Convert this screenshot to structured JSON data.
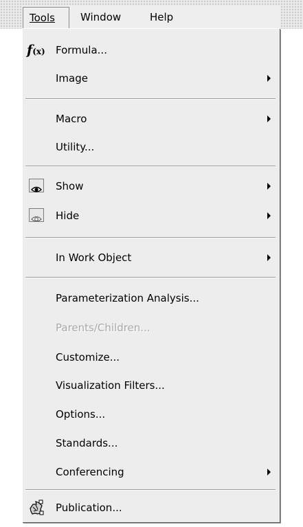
{
  "menubar": {
    "tools": "Tools",
    "window": "Window",
    "help": "Help"
  },
  "menu": {
    "formula": "Formula...",
    "image": "Image",
    "macro": "Macro",
    "utility": "Utility...",
    "show": "Show",
    "hide": "Hide",
    "in_work_object": "In Work Object",
    "parameterization": "Parameterization Analysis...",
    "parents_children": "Parents/Children...",
    "customize": "Customize...",
    "visualization_filters": "Visualization Filters...",
    "options": "Options...",
    "standards": "Standards...",
    "conferencing": "Conferencing",
    "publication": "Publication..."
  },
  "icons": {
    "formula": "fx-icon",
    "show": "eye-icon",
    "hide": "eye-hidden-icon",
    "publication": "publication-icon",
    "submenu": "chevron-right-icon"
  }
}
